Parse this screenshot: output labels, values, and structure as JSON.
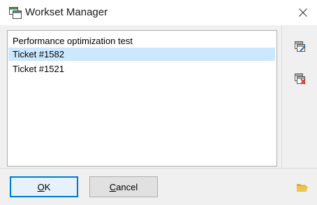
{
  "window": {
    "title": "Workset Manager",
    "title_icon": "workset-icon",
    "close_icon": "close-icon"
  },
  "list": {
    "items": [
      {
        "label": "Performance optimization test",
        "selected": false
      },
      {
        "label": "Ticket #1582",
        "selected": true
      },
      {
        "label": "Ticket #1521",
        "selected": false
      }
    ]
  },
  "side_toolbar": {
    "edit_icon": "edit-workset-icon",
    "delete_icon": "delete-workset-icon"
  },
  "footer": {
    "ok_mnemonic": "O",
    "ok_rest": "K",
    "cancel_mnemonic": "C",
    "cancel_rest": "ancel",
    "folder_icon": "open-folder-icon"
  },
  "colors": {
    "selection": "#cce8ff",
    "accent": "#0078d7"
  }
}
